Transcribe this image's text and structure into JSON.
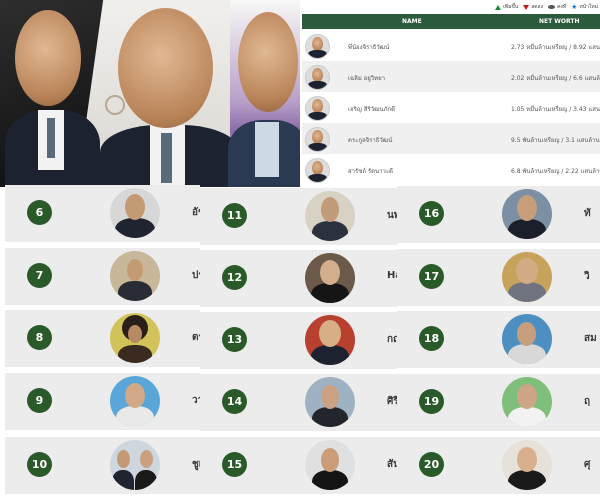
{
  "top_table": {
    "legend": [
      "เพิ่มขึ้น",
      "ลดลง",
      "คงที่",
      "หน้าใหม่"
    ],
    "columns": {
      "name": "NAME",
      "net_worth": "NET WORTH"
    },
    "rows": [
      {
        "name": "พี่น้องจิราธิวัฒน์",
        "net_worth": "2.73 หมื่นล้านเหรียญ / 8.92 แสนล้านบ"
      },
      {
        "name": "เฉลิม อยู่วิทยา",
        "net_worth": "2.02 หมื่นล้านเหรียญ / 6.6 แสนล้านบ"
      },
      {
        "name": "เจริญ สิริวัฒนภักดี",
        "net_worth": "1.05 หมื่นล้านเหรียญ / 3.43 แสนล้าน"
      },
      {
        "name": "ตระกูลจิราธิวัฒน์",
        "net_worth": "9.5 พันล้านเหรียญ / 3.1 แสนล้านบาท"
      },
      {
        "name": "สารัชถ์ รัตนาวะดี",
        "net_worth": "6.8 พันล้านเหรียญ / 2.22 แสนล้านบ"
      }
    ]
  },
  "ranks": [
    {
      "rank": "6",
      "name": "อัช"
    },
    {
      "rank": "7",
      "name": "ประ"
    },
    {
      "rank": "8",
      "name": "ตร"
    },
    {
      "rank": "9",
      "name": "วา"
    },
    {
      "rank": "10",
      "name": "ชูเ"
    },
    {
      "rank": "11",
      "name": "นพ"
    },
    {
      "rank": "12",
      "name": "Har"
    },
    {
      "rank": "13",
      "name": "กฤ"
    },
    {
      "rank": "14",
      "name": "ศิรี"
    },
    {
      "rank": "15",
      "name": "สันต"
    },
    {
      "rank": "16",
      "name": "ทั"
    },
    {
      "rank": "17",
      "name": "วิ"
    },
    {
      "rank": "18",
      "name": "สม"
    },
    {
      "rank": "19",
      "name": "ฤ"
    },
    {
      "rank": "20",
      "name": "ศุ"
    }
  ],
  "colors": {
    "badge": "#2b5a2a",
    "header": "#2b5a3c",
    "card": "#ececec",
    "up": "#1f8a3a",
    "down": "#c21d1d"
  }
}
